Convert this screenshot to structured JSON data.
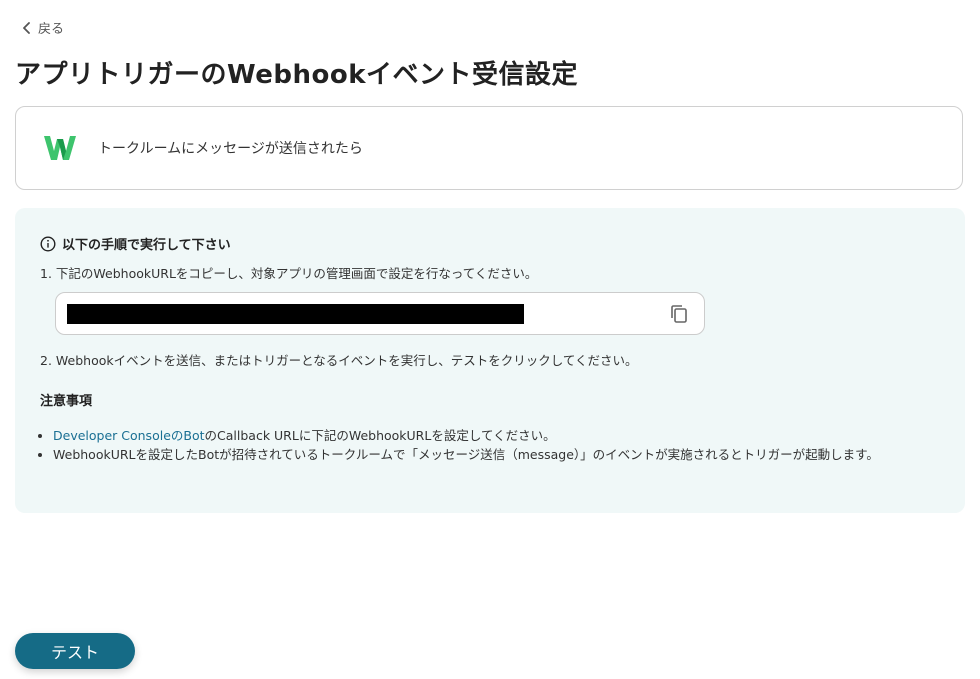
{
  "nav": {
    "back_label": "戻る"
  },
  "page_title": "アプリトリガーのWebhookイベント受信設定",
  "trigger": {
    "label": "トークルームにメッセージが送信されたら",
    "logo_letter": "W"
  },
  "instructions": {
    "heading": "以下の手順で実行して下さい",
    "step1": "1. 下記のWebhookURLをコピーし、対象アプリの管理画面で設定を行なってください。",
    "step2": "2. Webhookイベントを送信、またはトリガーとなるイベントを実行し、テストをクリックしてください。"
  },
  "notes": {
    "heading": "注意事項",
    "item1_link": "Developer ConsoleのBot",
    "item1_text": "のCallback URLに下記のWebhookURLを設定してください。",
    "item2_text": "WebhookURLを設定したBotが招待されているトークルームで「メッセージ送信（message）」のイベントが実施されるとトリガーが起動します。"
  },
  "test_button_label": "テスト",
  "colors": {
    "primary_button": "#156b86",
    "link": "#1a6f93",
    "panel_bg": "#f0f8f8",
    "logo_green": "#3ec46d"
  },
  "icons": {
    "back": "chevron-left-icon",
    "info": "info-icon",
    "copy": "copy-icon"
  }
}
